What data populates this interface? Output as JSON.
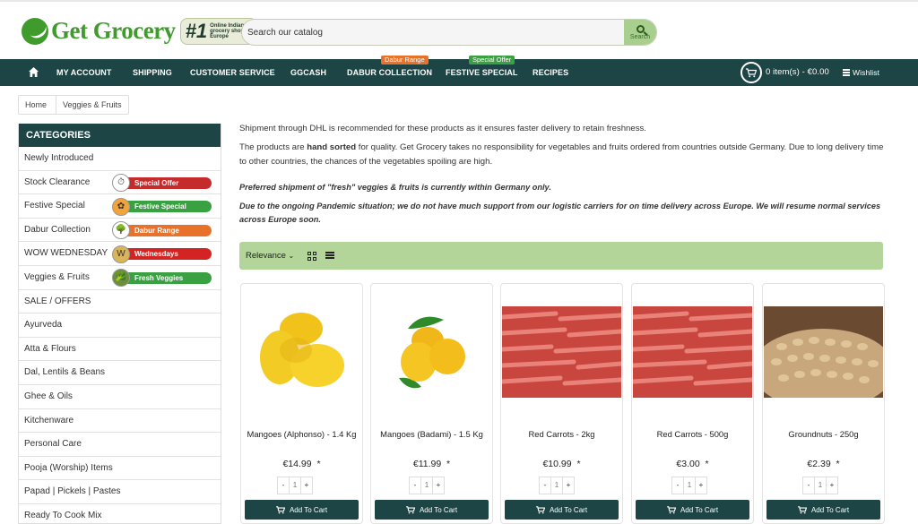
{
  "brand": {
    "name": "Get Grocery",
    "badge_num": "#1",
    "badge_tag": "Online Indian grocery shop in Europe",
    "green": "#3f9b2c",
    "dark_teal": "#1e4546"
  },
  "search": {
    "placeholder": "Search our catalog",
    "button_label": "Search"
  },
  "nav": {
    "items": [
      "MY ACCOUNT",
      "SHIPPING",
      "CUSTOMER SERVICE",
      "GGCASH",
      "DABUR COLLECTION",
      "FESTIVE SPECIAL",
      "RECIPES"
    ],
    "badges": {
      "dabur": "Dabur Range",
      "festive": "Special Offer"
    },
    "cart": "0 item(s) - €0.00",
    "wishlist": "Wishlist"
  },
  "breadcrumb": [
    "Home",
    "Veggies & Fruits"
  ],
  "sidebar": {
    "title": "CATEGORIES",
    "items": [
      "Newly Introduced",
      "Stock Clearance",
      "Festive Special",
      "Dabur Collection",
      "WOW WEDNESDAY",
      "Veggies & Fruits",
      "SALE / OFFERS",
      "Ayurveda",
      "Atta & Flours",
      "Dal, Lentils & Beans",
      "Ghee & Oils",
      "Kitchenware",
      "Personal Care",
      "Pooja (Worship) Items",
      "Papad | Pickels | Pastes",
      "Ready To Cook Mix"
    ],
    "badges": [
      {
        "label": "Special Offer",
        "color": "#c62b2b"
      },
      {
        "label": "Festive Special",
        "color": "#3aa142"
      },
      {
        "label": "Dabur Range",
        "color": "#e9722a"
      },
      {
        "label": "Wednesdays",
        "color": "#d42323"
      },
      {
        "label": "Fresh Veggies",
        "color": "#3aa142"
      }
    ]
  },
  "content": {
    "line1": "Shipment through DHL is recommended for these products as it ensures faster delivery to retain freshness.",
    "line2_pre": "The products are ",
    "line2_bold": "hand sorted",
    "line2_post": " for quality. Get Grocery takes no responsibility for vegetables and fruits ordered from countries outside Germany. Due to long delivery time to other countries, the chances of the vegetables spoiling are high.",
    "note1": "Preferred shipment of \"fresh\" veggies & fruits is currently within Germany only.",
    "note2": "Due to the ongoing Pandemic situation; we do not have much support from our logistic carriers for on time delivery across Europe. We will resume normal services across Europe soon."
  },
  "toolbar": {
    "sort_label": "Relevance"
  },
  "products": [
    {
      "name": "Mangoes (Alphonso) - 1.4 Kg",
      "price": "€14.99",
      "qty": "1",
      "button": "Add To Cart"
    },
    {
      "name": "Mangoes (Badami) - 1.5 Kg",
      "price": "€11.99",
      "qty": "1",
      "button": "Add To Cart"
    },
    {
      "name": "Red Carrots - 2kg",
      "price": "€10.99",
      "qty": "1",
      "button": "Add To Cart"
    },
    {
      "name": "Red Carrots - 500g",
      "price": "€3.00",
      "qty": "1",
      "button": "Add To Cart"
    },
    {
      "name": "Groundnuts - 250g",
      "price": "€2.39",
      "qty": "1",
      "button": "Add To Cart"
    }
  ],
  "price_suffix": "*",
  "qty_minus": "-",
  "qty_plus": "+"
}
